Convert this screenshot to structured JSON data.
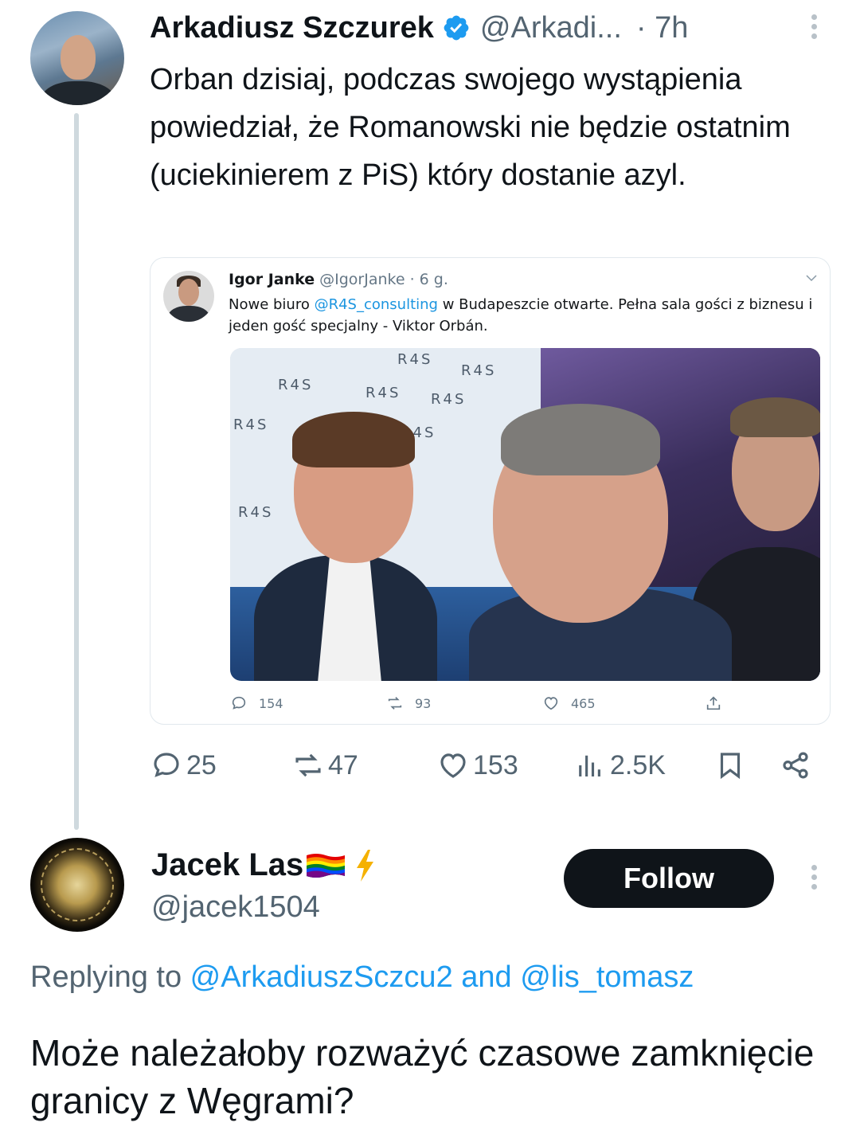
{
  "parent_tweet": {
    "author_name": "Arkadiusz Szczurek",
    "author_handle": "@Arkadi...",
    "time": "· 7h",
    "text": "Orban dzisiaj, podczas swojego wystąpienia powiedział, że Romanowski nie będzie ostatnim (uciekinierem z PiS) który dostanie azyl.",
    "actions": {
      "replies": "25",
      "reposts": "47",
      "likes": "153",
      "views": "2.5K"
    },
    "quoted_screenshot": {
      "author_name": "Igor Janke",
      "author_handle": "@IgorJanke · 6 g.",
      "text_before": "Nowe biuro ",
      "mention": "@R4S_consulting",
      "text_after": " w Budapeszcie otwarte. Pełna sala gości z biznesu i jeden gość specjalny - Viktor Orbán.",
      "photo_logo": "R4S",
      "actions": {
        "replies": "154",
        "reposts": "93",
        "likes": "465"
      }
    }
  },
  "reply_tweet": {
    "author_name": "Jacek Las",
    "author_handle": "@jacek1504",
    "follow_label": "Follow",
    "replying_prefix": "Replying to ",
    "replying_to_1": "@ArkadiuszSczcu2",
    "replying_and": " and ",
    "replying_to_2": "@lis_tomasz",
    "text": "Może należałoby rozważyć czasowe zamknięcie granicy z Węgrami?"
  },
  "colors": {
    "text_primary": "#0f1419",
    "text_secondary": "#536471",
    "link_blue": "#1d9bf0",
    "verified_blue": "#1d9bf0",
    "follow_button_bg": "#0f1419"
  },
  "icons": [
    "verified-badge-icon",
    "more-icon",
    "reply-icon",
    "repost-icon",
    "like-icon",
    "views-icon",
    "bookmark-icon",
    "share-icon",
    "chevron-down-icon",
    "rainbow-flag-icon",
    "lightning-icon"
  ]
}
